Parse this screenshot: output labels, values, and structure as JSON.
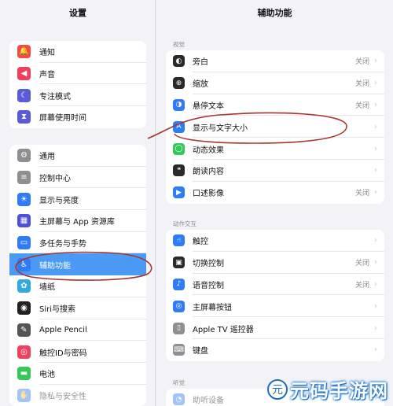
{
  "sidebar": {
    "title": "设置",
    "group1": [
      {
        "label": "通知",
        "icon": "bell-icon",
        "color": "#f14b44",
        "glyph": "🔔"
      },
      {
        "label": "声音",
        "icon": "speaker-icon",
        "color": "#f0405d",
        "glyph": "◀"
      },
      {
        "label": "专注模式",
        "icon": "moon-icon",
        "color": "#5b5bd8",
        "glyph": "☾"
      },
      {
        "label": "屏幕使用时间",
        "icon": "hourglass-icon",
        "color": "#5b5bd8",
        "glyph": "⧗"
      }
    ],
    "group2": [
      {
        "label": "通用",
        "icon": "gear-icon",
        "color": "#8e8e93",
        "glyph": "⚙"
      },
      {
        "label": "控制中心",
        "icon": "toggles-icon",
        "color": "#8e8e93",
        "glyph": "≡"
      },
      {
        "label": "显示与亮度",
        "icon": "sun-icon",
        "color": "#2f7cf6",
        "glyph": "☀"
      },
      {
        "label": "主屏幕与 App 资源库",
        "icon": "grid-icon",
        "color": "#4f51d4",
        "glyph": "▦"
      },
      {
        "label": "多任务与手势",
        "icon": "multitask-icon",
        "color": "#2f7cf6",
        "glyph": "▭"
      },
      {
        "label": "辅助功能",
        "icon": "accessibility-icon",
        "color": "#2f7cf6",
        "glyph": "♿",
        "selected": true
      },
      {
        "label": "墙纸",
        "icon": "flower-icon",
        "color": "#33aadc",
        "glyph": "✿"
      },
      {
        "label": "Siri与搜索",
        "icon": "siri-icon",
        "color": "#222222",
        "glyph": "◉"
      },
      {
        "label": "Apple Pencil",
        "icon": "pencil-icon",
        "color": "#555555",
        "glyph": "✎"
      },
      {
        "label": "触控ID与密码",
        "icon": "fingerprint-icon",
        "color": "#f0405d",
        "glyph": "◎"
      },
      {
        "label": "电池",
        "icon": "battery-icon",
        "color": "#34c759",
        "glyph": "▬"
      },
      {
        "label": "隐私与安全性",
        "icon": "hand-icon",
        "color": "#2f7cf6",
        "glyph": "✋",
        "faded": true
      }
    ]
  },
  "main": {
    "title": "辅助功能",
    "section_vision": "视觉",
    "section_interaction": "动作交互",
    "section_hearing": "听觉",
    "vision_rows": [
      {
        "label": "旁白",
        "value": "关闭",
        "icon": "voiceover-icon",
        "color": "#2a2a2a",
        "glyph": "◐"
      },
      {
        "label": "缩放",
        "value": "关闭",
        "icon": "zoom-icon",
        "color": "#2a2a2a",
        "glyph": "⊕"
      },
      {
        "label": "悬停文本",
        "value": "关闭",
        "icon": "hover-text-icon",
        "color": "#2f7cf6",
        "glyph": "◑"
      },
      {
        "label": "显示与文字大小",
        "value": "",
        "icon": "text-size-icon",
        "color": "#2f7cf6",
        "glyph": "A"
      },
      {
        "label": "动态效果",
        "value": "",
        "icon": "motion-icon",
        "color": "#34c759",
        "glyph": "◯"
      },
      {
        "label": "朗读内容",
        "value": "",
        "icon": "speech-icon",
        "color": "#2a2a2a",
        "glyph": "❝"
      },
      {
        "label": "口述影像",
        "value": "关闭",
        "icon": "audio-description-icon",
        "color": "#2f7cf6",
        "glyph": "▶"
      }
    ],
    "interaction_rows": [
      {
        "label": "触控",
        "value": "",
        "icon": "touch-icon",
        "color": "#2f7cf6",
        "glyph": "☝"
      },
      {
        "label": "切换控制",
        "value": "关闭",
        "icon": "switch-control-icon",
        "color": "#2a2a2a",
        "glyph": "▣"
      },
      {
        "label": "语音控制",
        "value": "关闭",
        "icon": "voice-control-icon",
        "color": "#2f7cf6",
        "glyph": "♪"
      },
      {
        "label": "主屏幕按钮",
        "value": "",
        "icon": "home-button-icon",
        "color": "#2f7cf6",
        "glyph": "◎"
      },
      {
        "label": "Apple TV 遥控器",
        "value": "",
        "icon": "remote-icon",
        "color": "#8e8e93",
        "glyph": "▯"
      },
      {
        "label": "键盘",
        "value": "",
        "icon": "keyboard-icon",
        "color": "#8e8e93",
        "glyph": "⌨"
      }
    ],
    "hearing_rows": [
      {
        "label": "助听设备",
        "value": "",
        "icon": "ear-icon",
        "color": "#2f7cf6",
        "glyph": "◔",
        "faded": true
      }
    ]
  },
  "annotation_color": "#a8342e",
  "watermark": {
    "text": "元码手游网",
    "logo_glyph": "元"
  }
}
